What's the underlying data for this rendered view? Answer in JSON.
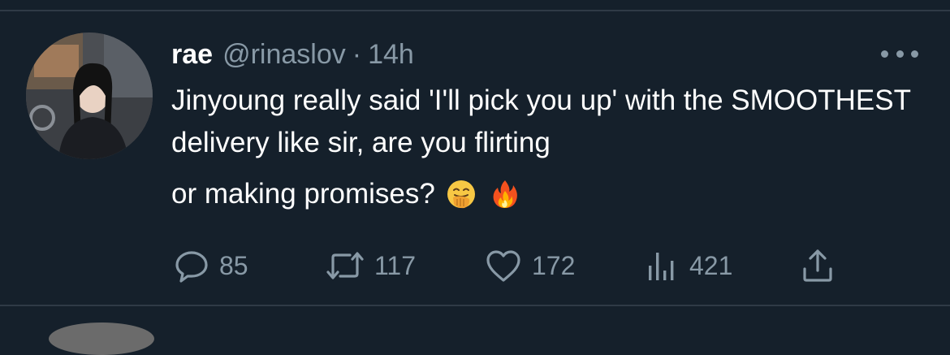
{
  "tweet": {
    "display_name": "rae",
    "handle": "@rinaslov",
    "separator": "·",
    "time": "14h",
    "text_main": "Jinyoung really said 'I'll pick you up' with the SMOOTHEST delivery like sir, are you flirting",
    "text_end": "or making promises?"
  },
  "actions": {
    "replies": "85",
    "retweets": "117",
    "likes": "172",
    "views": "421"
  },
  "icons": {
    "more": "more-horizontal-icon",
    "reply": "reply-icon",
    "retweet": "retweet-icon",
    "like": "heart-icon",
    "views": "views-chart-icon",
    "share": "share-icon",
    "emoji_1": "face-with-hand-over-mouth-emoji",
    "emoji_2": "fire-emoji"
  },
  "colors": {
    "background": "#15202b",
    "text_primary": "#ffffff",
    "text_secondary": "#8899a6",
    "divider": "#2f3a46"
  }
}
